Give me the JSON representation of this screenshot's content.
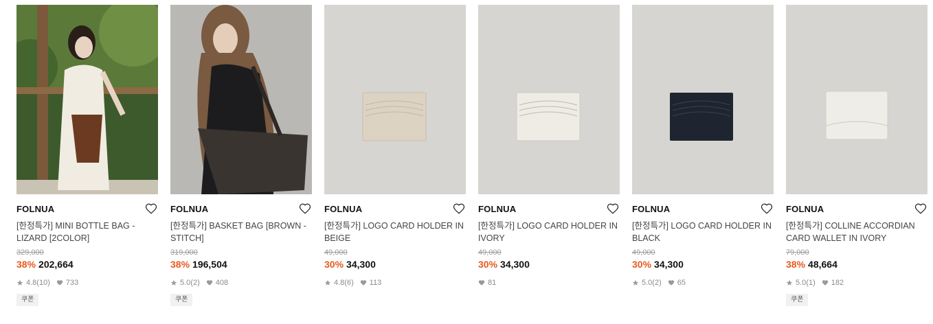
{
  "products": [
    {
      "brand": "FOLNUA",
      "title": "[한정특가] MINI BOTTLE BAG - LIZARD [2COLOR]",
      "original_price": "329,000",
      "discount": "38%",
      "price": "202,664",
      "rating": "4.8",
      "reviews": "(10)",
      "likes": "733",
      "coupon": "쿠폰"
    },
    {
      "brand": "FOLNUA",
      "title": "[한정특가] BASKET BAG [BROWN - STITCH]",
      "original_price": "319,000",
      "discount": "38%",
      "price": "196,504",
      "rating": "5.0",
      "reviews": "(2)",
      "likes": "408",
      "coupon": "쿠폰"
    },
    {
      "brand": "FOLNUA",
      "title": "[한정특가] LOGO CARD HOLDER IN BEIGE",
      "original_price": "49,000",
      "discount": "30%",
      "price": "34,300",
      "rating": "4.8",
      "reviews": "(6)",
      "likes": "113"
    },
    {
      "brand": "FOLNUA",
      "title": "[한정특가] LOGO CARD HOLDER IN IVORY",
      "original_price": "49,000",
      "discount": "30%",
      "price": "34,300",
      "likes": "81"
    },
    {
      "brand": "FOLNUA",
      "title": "[한정특가] LOGO CARD HOLDER IN BLACK",
      "original_price": "49,000",
      "discount": "30%",
      "price": "34,300",
      "rating": "5.0",
      "reviews": "(2)",
      "likes": "65"
    },
    {
      "brand": "FOLNUA",
      "title": "[한정특가] COLLINE ACCORDIAN CARD WALLET IN IVORY",
      "original_price": "79,000",
      "discount": "38%",
      "price": "48,664",
      "rating": "5.0",
      "reviews": "(1)",
      "likes": "182",
      "coupon": "쿠폰"
    }
  ],
  "colors": {
    "discount": "#e8591f",
    "product_bg": "#d6d5d1",
    "beige_holder": "#dcd3c2",
    "ivory_holder": "#eeece5",
    "black_holder": "#1f2530"
  },
  "icons": {
    "like": "heart-outline-icon",
    "rating": "star-icon",
    "likes_count": "heart-filled-icon"
  }
}
